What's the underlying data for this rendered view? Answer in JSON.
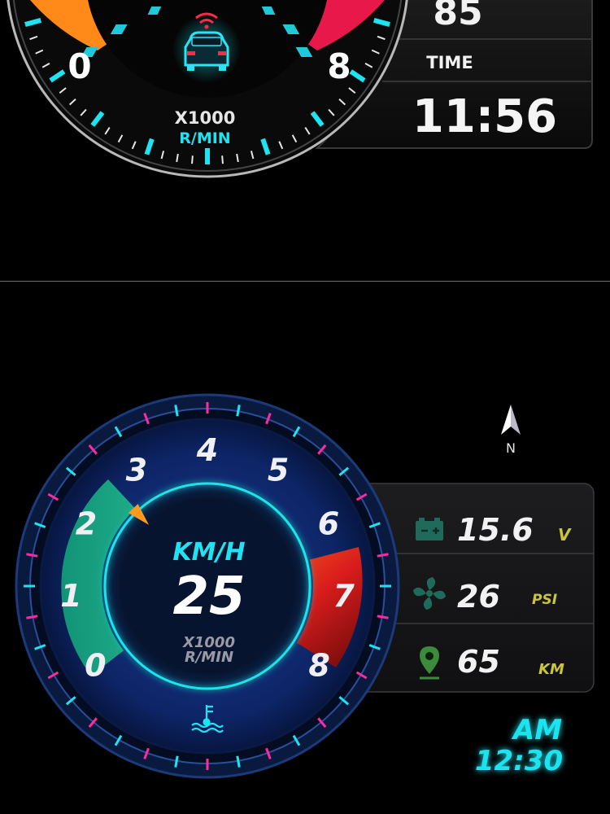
{
  "top_gauge": {
    "scale_min": "0",
    "scale_max": "8",
    "unit_line1": "X1000",
    "unit_line2": "R/MIN",
    "car_icon": "car-wifi-icon"
  },
  "top_panel": {
    "value_top": "85",
    "time_label": "TIME",
    "time_value": "11:56"
  },
  "bottom_gauge": {
    "speed_label": "KM/H",
    "speed_value": "25",
    "unit_line1": "X1000",
    "unit_line2": "R/MIN",
    "scale": [
      "0",
      "1",
      "2",
      "3",
      "4",
      "5",
      "6",
      "7",
      "8"
    ],
    "needle_value": 2.6,
    "temp_icon": "coolant-temperature-icon"
  },
  "compass": {
    "label": "N",
    "icon": "north-arrow-icon"
  },
  "info": {
    "rows": [
      {
        "icon": "battery-icon",
        "value": "15.6",
        "unit": "V"
      },
      {
        "icon": "fan-icon",
        "value": "26",
        "unit": "PSI"
      },
      {
        "icon": "location-pin-icon",
        "value": "65",
        "unit": "KM"
      }
    ]
  },
  "clock": {
    "period": "AM",
    "time": "12:30"
  },
  "colors": {
    "cyan": "#1ee3f0",
    "orange": "#ff8a1a",
    "crimson": "#e8194a",
    "green": "#22b98a",
    "navy": "#0e2a6e",
    "magenta": "#ff2aa0",
    "olive_unit": "#c9c63a"
  }
}
